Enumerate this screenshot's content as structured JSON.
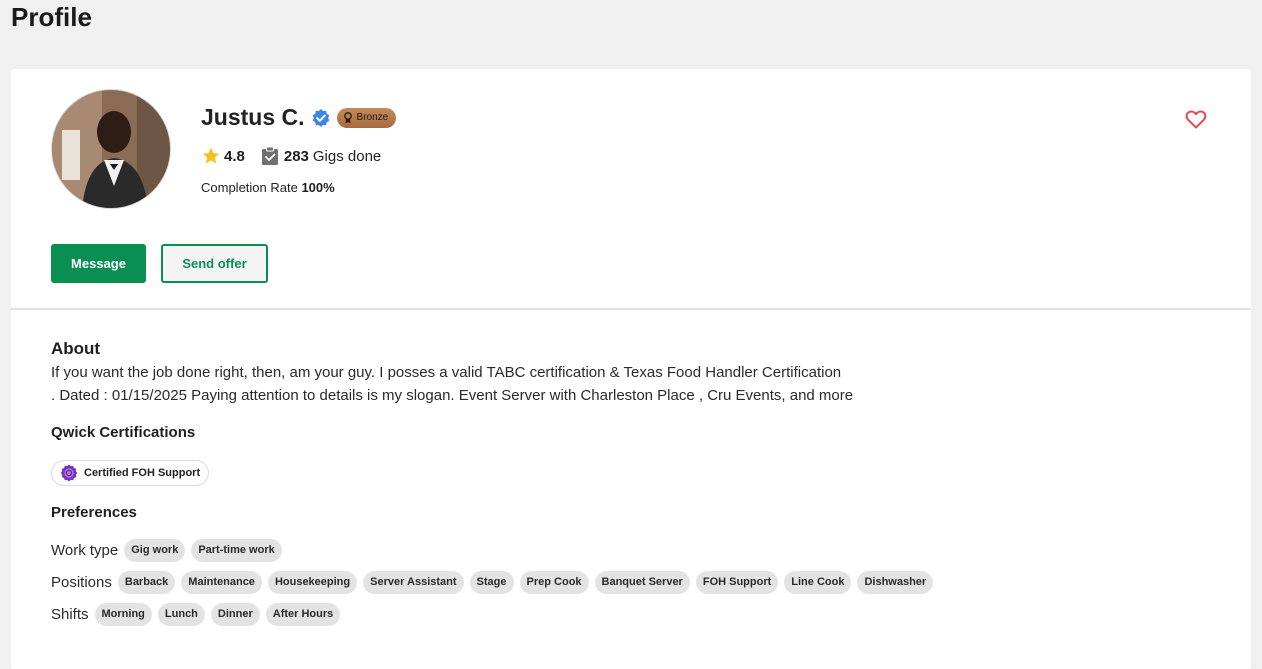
{
  "page": {
    "title": "Profile"
  },
  "profile": {
    "name": "Justus C.",
    "tier_badge": "Bronze",
    "rating": "4.8",
    "gigs_count": "283",
    "gigs_label": "Gigs done",
    "completion_label": "Completion Rate",
    "completion_value": "100%",
    "icons": [
      "star-icon",
      "clipboard-check-icon",
      "verified-icon",
      "heart-icon",
      "medal-icon"
    ]
  },
  "actions": {
    "message_label": "Message",
    "send_offer_label": "Send offer"
  },
  "about": {
    "title": "About",
    "text_line1": "If you want the job done right, then, am your guy. I posses a valid TABC certification & Texas Food Handler Certification",
    "text_line2": ". Dated : 01/15/2025 Paying attention to details is my slogan. Event Server with Charleston Place , Cru Events, and more"
  },
  "certifications": {
    "title": "Qwick Certifications",
    "items": [
      {
        "label": "Certified FOH Support"
      }
    ]
  },
  "preferences": {
    "title": "Preferences",
    "work_type": {
      "label": "Work type",
      "chips": [
        "Gig work",
        "Part-time work"
      ]
    },
    "positions": {
      "label": "Positions",
      "chips": [
        "Barback",
        "Maintenance",
        "Housekeeping",
        "Server Assistant",
        "Stage",
        "Prep Cook",
        "Banquet Server",
        "FOH Support",
        "Line Cook",
        "Dishwasher"
      ]
    },
    "shifts": {
      "label": "Shifts",
      "chips": [
        "Morning",
        "Lunch",
        "Dinner",
        "After Hours"
      ]
    }
  },
  "colors": {
    "primary_green": "#0a8f53",
    "verified_blue": "#3d86e6",
    "heart_red": "#e5484d",
    "star_yellow": "#f4c21b",
    "bronze": "#b8794a",
    "cert_purple": "#7b2fbe"
  }
}
